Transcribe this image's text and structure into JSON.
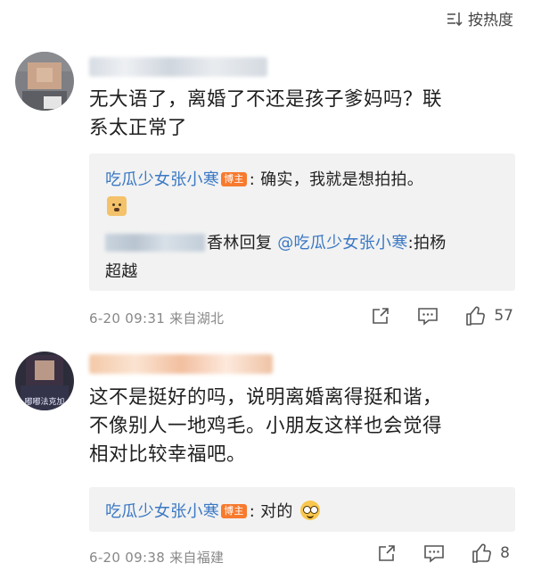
{
  "sort": {
    "label": "按热度",
    "icon": "sort-icon"
  },
  "comments": [
    {
      "text_line1": "无大语了，离婚了不还是孩子爹妈吗？联",
      "text_line2": "系太正常了",
      "replies": [
        {
          "user": "吃瓜少女张小寒",
          "badge": "博主",
          "text": ": 确实，我就是想拍拍。",
          "emoji": "doge-emoji"
        },
        {
          "prefix": "香林回复",
          "mention": "@吃瓜少女张小寒",
          "text": ":拍杨",
          "text2": "超越"
        }
      ],
      "time": "6-20 09:31",
      "location": "来自湖北",
      "likes": "57"
    },
    {
      "avatar_text": "嘟嘟法克加",
      "text_line1": "这不是挺好的吗，说明离婚离得挺和谐，",
      "text_line2": "不像别人一地鸡毛。小朋友这样也会觉得",
      "text_line3": "相对比较幸福吧。",
      "replies": [
        {
          "user": "吃瓜少女张小寒",
          "badge": "博主",
          "text": ": 对的",
          "emoji": "nerd-emoji"
        }
      ],
      "time": "6-20 09:38",
      "location": "来自福建",
      "likes": "8"
    }
  ],
  "colors": {
    "link": "#3a78c4",
    "badge": "#f77a2e",
    "reply_bg": "#f2f2f2"
  }
}
